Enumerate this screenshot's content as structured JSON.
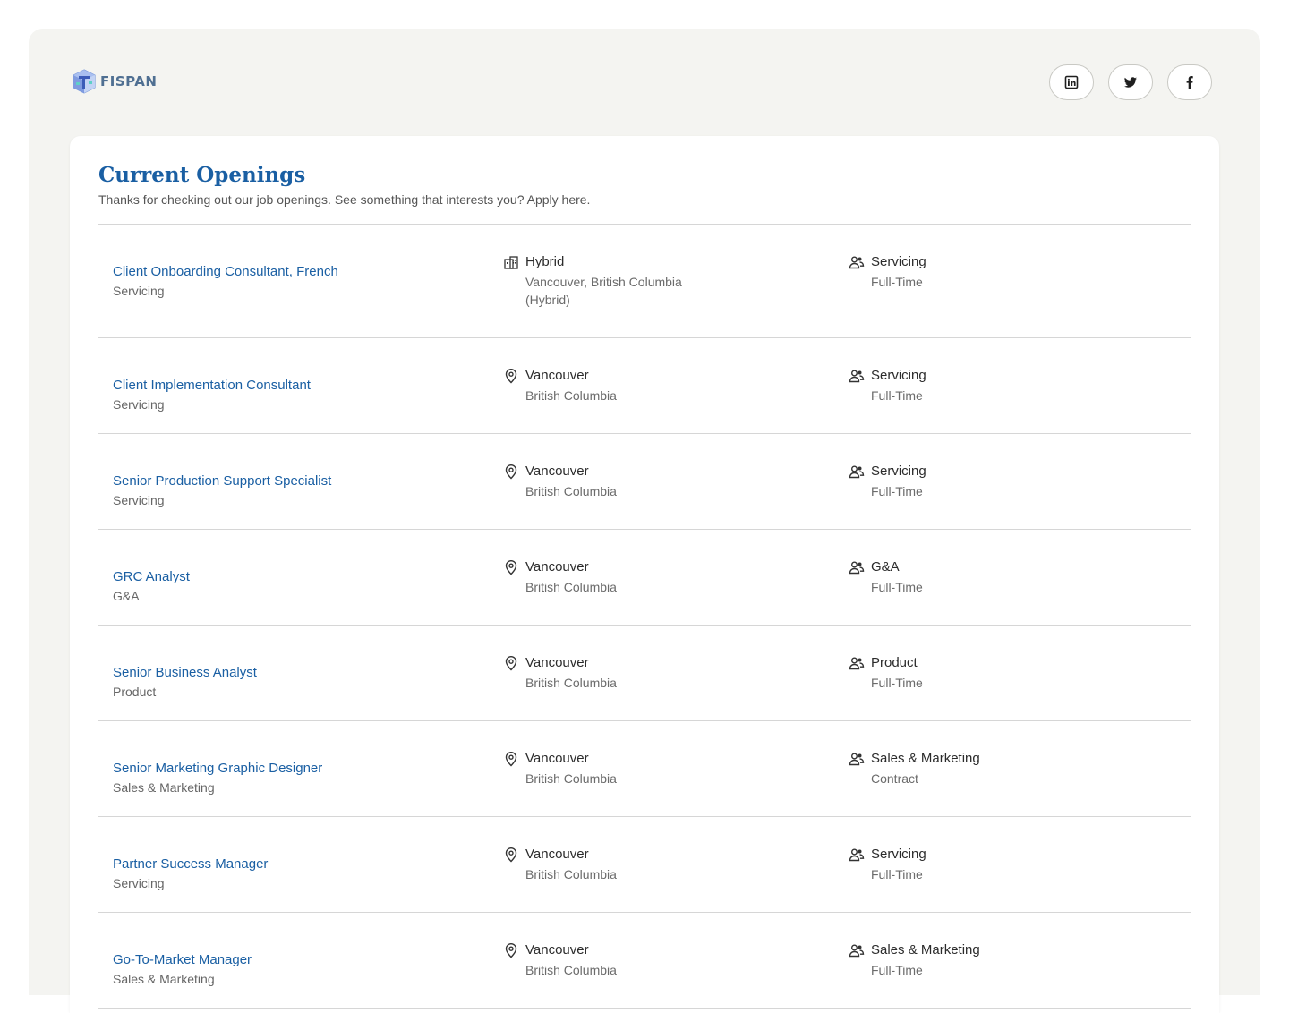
{
  "brand": {
    "name": "FISPAN"
  },
  "social": [
    {
      "icon": "linkedin-icon",
      "label": "LinkedIn"
    },
    {
      "icon": "twitter-icon",
      "label": "Twitter"
    },
    {
      "icon": "facebook-icon",
      "label": "Facebook"
    }
  ],
  "openings": {
    "title": "Current Openings",
    "subtitle": "Thanks for checking out our job openings. See something that interests you? Apply here.",
    "jobs": [
      {
        "title": "Client Onboarding Consultant, French",
        "department": "Servicing",
        "location_icon": "building-icon",
        "location": "Hybrid",
        "location_detail": "Vancouver, British Columbia (Hybrid)",
        "team": "Servicing",
        "employment": "Full-Time"
      },
      {
        "title": "Client Implementation Consultant",
        "department": "Servicing",
        "location_icon": "map-pin-icon",
        "location": "Vancouver",
        "location_detail": "British Columbia",
        "team": "Servicing",
        "employment": "Full-Time"
      },
      {
        "title": "Senior Production Support Specialist",
        "department": "Servicing",
        "location_icon": "map-pin-icon",
        "location": "Vancouver",
        "location_detail": "British Columbia",
        "team": "Servicing",
        "employment": "Full-Time"
      },
      {
        "title": "GRC Analyst",
        "department": "G&A",
        "location_icon": "map-pin-icon",
        "location": "Vancouver",
        "location_detail": "British Columbia",
        "team": "G&A",
        "employment": "Full-Time"
      },
      {
        "title": "Senior Business Analyst",
        "department": "Product",
        "location_icon": "map-pin-icon",
        "location": "Vancouver",
        "location_detail": "British Columbia",
        "team": "Product",
        "employment": "Full-Time"
      },
      {
        "title": "Senior Marketing Graphic Designer",
        "department": "Sales & Marketing",
        "location_icon": "map-pin-icon",
        "location": "Vancouver",
        "location_detail": "British Columbia",
        "team": "Sales & Marketing",
        "employment": "Contract"
      },
      {
        "title": "Partner Success Manager",
        "department": "Servicing",
        "location_icon": "map-pin-icon",
        "location": "Vancouver",
        "location_detail": "British Columbia",
        "team": "Servicing",
        "employment": "Full-Time"
      },
      {
        "title": "Go-To-Market Manager",
        "department": "Sales & Marketing",
        "location_icon": "map-pin-icon",
        "location": "Vancouver",
        "location_detail": "British Columbia",
        "team": "Sales & Marketing",
        "employment": "Full-Time"
      }
    ]
  },
  "colors": {
    "accent": "#1a5fa3",
    "frame_background": "#f4f4f1",
    "card_background": "#ffffff",
    "divider": "#d6d6d6"
  }
}
